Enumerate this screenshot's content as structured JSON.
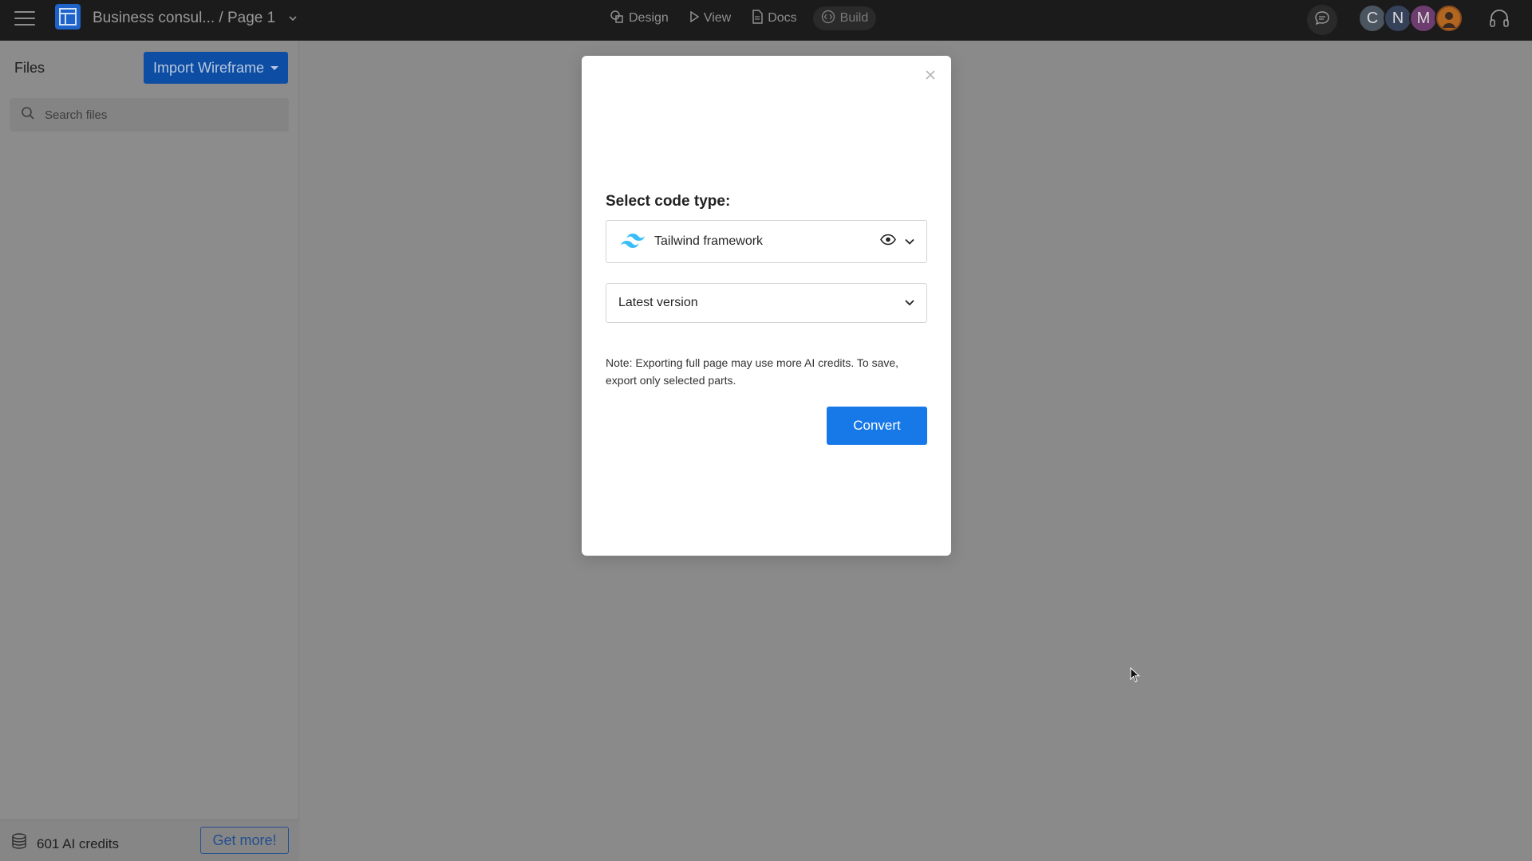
{
  "header": {
    "breadcrumb": "Business consul... / Page 1",
    "nav": [
      {
        "label": "Design",
        "icon": "shapes-icon"
      },
      {
        "label": "View",
        "icon": "play-icon"
      },
      {
        "label": "Docs",
        "icon": "document-icon"
      },
      {
        "label": "Build",
        "icon": "code-icon"
      }
    ],
    "avatars": [
      "C",
      "N",
      "M"
    ]
  },
  "sidebar": {
    "title": "Files",
    "import_label": "Import Wireframe",
    "search_placeholder": "Search files",
    "credits_label": "601 AI credits",
    "get_more_label": "Get more!"
  },
  "modal": {
    "label": "Select code type:",
    "framework": "Tailwind framework",
    "version": "Latest version",
    "note": "Note: Exporting full page may use more AI credits. To save, export only selected parts.",
    "convert_label": "Convert"
  },
  "colors": {
    "topbar": "#1b1b1b",
    "primary": "#1778e8",
    "tailwind": "#38bdf8"
  }
}
